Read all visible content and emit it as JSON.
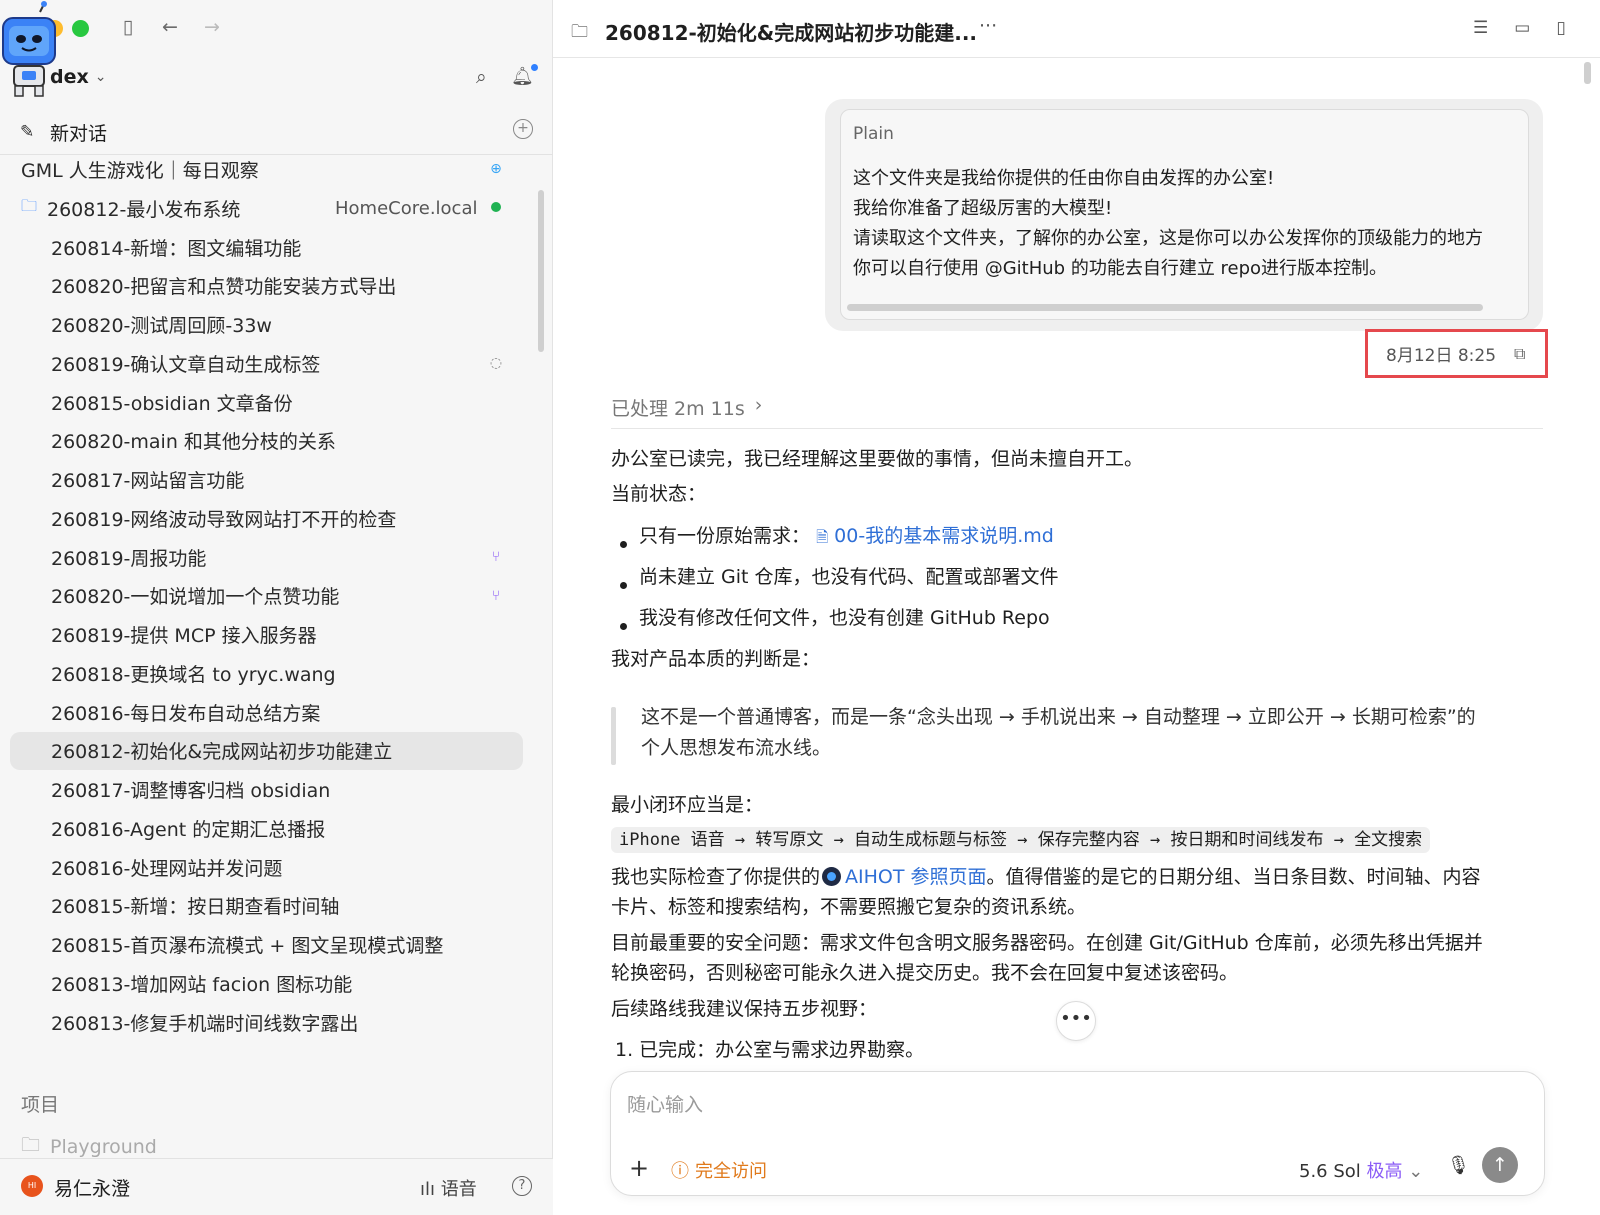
{
  "sidebar": {
    "app_name": "dex",
    "new_chat": "新对话",
    "pinned_top": "GML 人生游戏化｜每日观察",
    "project": {
      "name": "260812-最小发布系统",
      "host": "HomeCore.local"
    },
    "items": [
      {
        "label": "260814-新增：图文编辑功能",
        "status": ""
      },
      {
        "label": "260820-把留言和点赞功能安装方式导出",
        "status": ""
      },
      {
        "label": "260820-测试周回顾-33w",
        "status": ""
      },
      {
        "label": "260819-确认文章自动生成标签",
        "status": "spinner"
      },
      {
        "label": "260815-obsidian 文章备份",
        "status": ""
      },
      {
        "label": "260820-main 和其他分枝的关系",
        "status": ""
      },
      {
        "label": "260817-网站留言功能",
        "status": ""
      },
      {
        "label": "260819-网络波动导致网站打不开的检查",
        "status": ""
      },
      {
        "label": "260819-周报功能",
        "status": "branch"
      },
      {
        "label": "260820-一如说增加一个点赞功能",
        "status": "branch"
      },
      {
        "label": "260819-提供 MCP 接入服务器",
        "status": ""
      },
      {
        "label": "260818-更换域名 to yryc.wang",
        "status": ""
      },
      {
        "label": "260816-每日发布自动总结方案",
        "status": ""
      },
      {
        "label": "260812-初始化&完成网站初步功能建立",
        "status": "",
        "selected": true
      },
      {
        "label": "260817-调整博客归档 obsidian",
        "status": ""
      },
      {
        "label": "260816-Agent 的定期汇总播报",
        "status": ""
      },
      {
        "label": "260816-处理网站并发问题",
        "status": ""
      },
      {
        "label": "260815-新增：按日期查看时间轴",
        "status": ""
      },
      {
        "label": "260815-首页瀑布流模式 + 图文呈现模式调整",
        "status": ""
      },
      {
        "label": "260813-增加网站 facion 图标功能",
        "status": ""
      },
      {
        "label": "260813-修复手机端时间线数字露出",
        "status": ""
      }
    ],
    "section_title": "项目",
    "playground": "Playground",
    "user": {
      "name": "易仁永澄",
      "avatar_text": "HI"
    },
    "voice_label": "语音"
  },
  "main": {
    "title": "260812-初始化&完成网站初步功能建...",
    "message": {
      "lang": "Plain",
      "lines": [
        "这个文件夹是我给你提供的任由你自由发挥的办公室!",
        "我给你准备了超级厉害的大模型!",
        "请读取这个文件夹，了解你的办公室，这是你可以办公发挥你的顶级能力的地方",
        "你可以自行使用 @GitHub 的功能去自行建立 repo进行版本控制。"
      ],
      "timestamp": "8月12日 8:25"
    },
    "processed": "已处理 2m 11s",
    "reply": {
      "intro": "办公室已读完，我已经理解这里要做的事情，但尚未擅自开工。",
      "status_heading": "当前状态：",
      "bullet1_prefix": "只有一份原始需求：",
      "bullet1_link": "00-我的基本需求说明.md",
      "bullet2": "尚未建立 Git 仓库，也没有代码、配置或部署文件",
      "bullet3": "我没有修改任何文件，也没有创建 GitHub Repo",
      "judgement": "我对产品本质的判断是：",
      "quote_line1": "这不是一个普通博客，而是一条“念头出现 → 手机说出来 → 自动整理 → 立即公开 → 长期可检索”的",
      "quote_line2": "个人思想发布流水线。",
      "loop_heading": "最小闭环应当是：",
      "pipeline": "iPhone 语音 → 转写原文 → 自动生成标题与标签 → 保存完整内容 → 按日期和时间线发布 → 全文搜索",
      "check_prefix": "我也实际检查了你提供的",
      "check_link": "AIHOT 参照页面",
      "check_suffix": "。值得借鉴的是它的日期分组、当日条目数、时间轴、内容",
      "check_line2": "卡片、标签和搜索结构，不需要照搬它复杂的资讯系统。",
      "security_line1": "目前最重要的安全问题：需求文件包含明文服务器密码。在创建 Git/GitHub 仓库前，必须先移出凭据并",
      "security_line2": "轮换密码，否则秘密可能永久进入提交历史。我不会在回复中复述该密码。",
      "roadmap": "后续路线我建议保持五步视野：",
      "step1": "1. 已完成：办公室与需求边界勘察。"
    },
    "composer": {
      "placeholder": "随心输入",
      "access": "完全访问",
      "model": "5.6 Sol",
      "level": "极高"
    }
  }
}
